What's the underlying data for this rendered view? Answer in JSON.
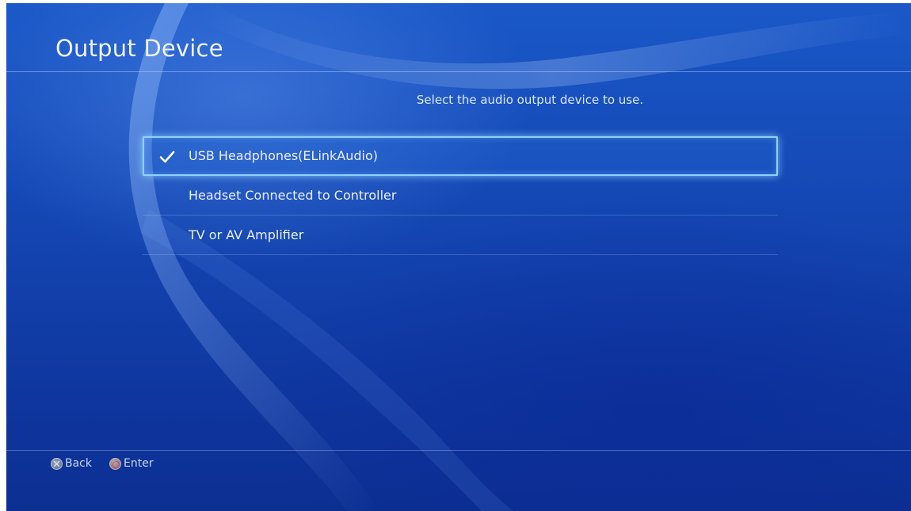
{
  "screen": {
    "title": "Output Device",
    "prompt": "Select the audio output device to use."
  },
  "devices": [
    {
      "label": "USB Headphones(ELinkAudio)",
      "selected": true,
      "focused": true,
      "icon": "checkmark-icon"
    },
    {
      "label": "Headset Connected to Controller",
      "selected": false,
      "focused": false
    },
    {
      "label": "TV or AV Amplifier",
      "selected": false,
      "focused": false
    }
  ],
  "footer": {
    "back": {
      "label": "Back",
      "icon": "cross-button-icon"
    },
    "enter": {
      "label": "Enter",
      "icon": "circle-button-icon"
    }
  },
  "colors": {
    "background": "#1447b4",
    "focus_outline": "#8fd0ff",
    "text": "#eaf1ff"
  }
}
